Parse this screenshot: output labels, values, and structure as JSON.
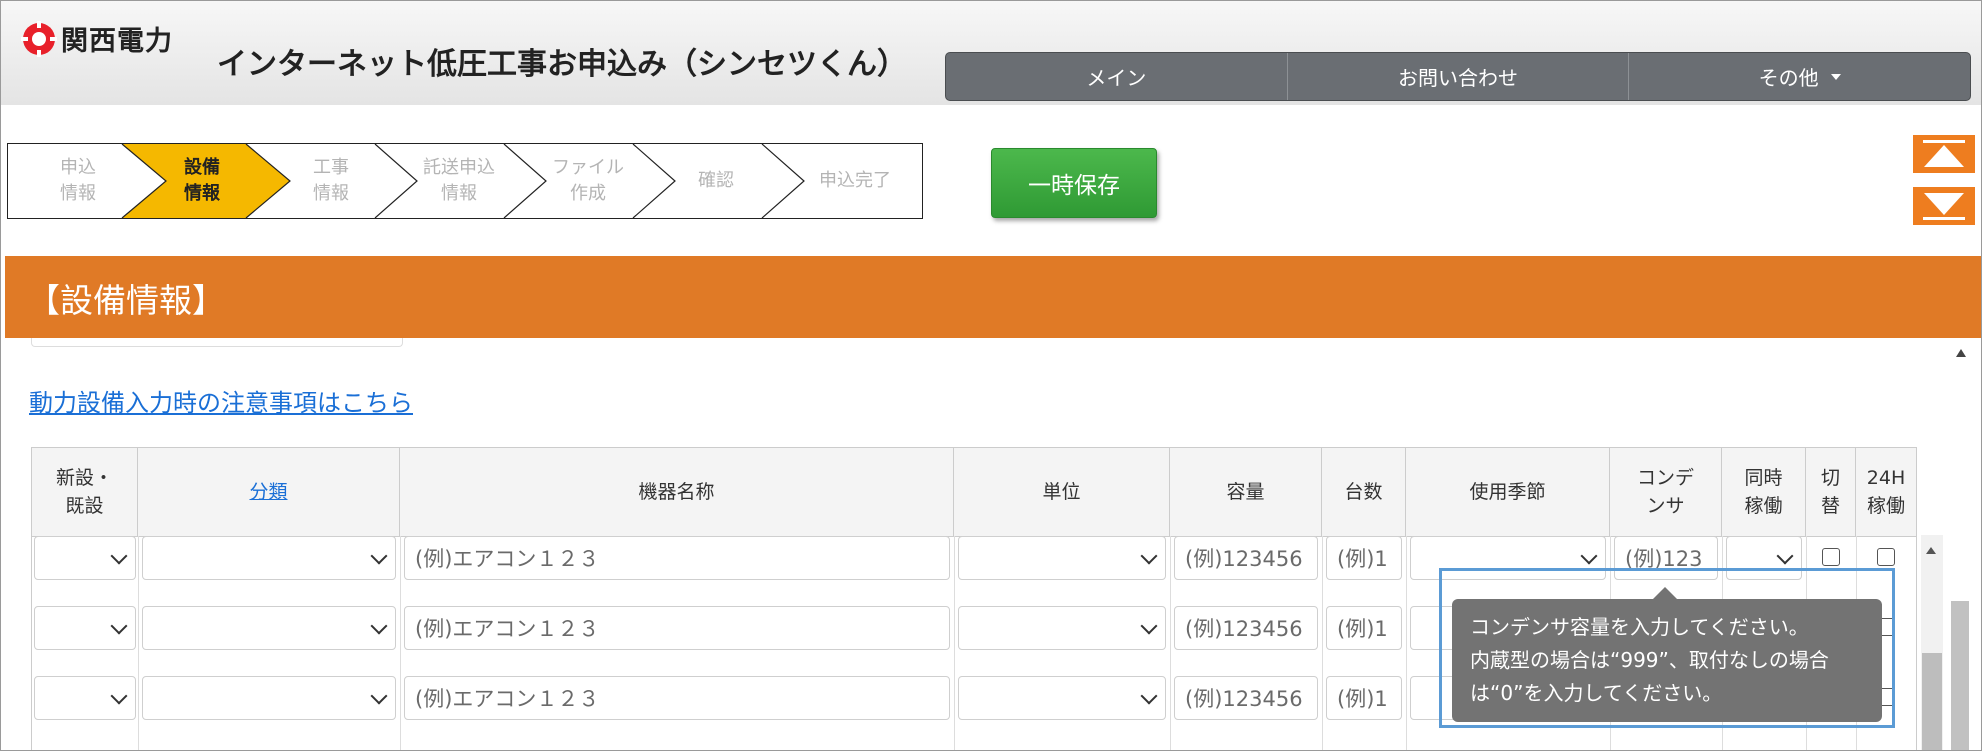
{
  "header": {
    "company": "関西電力",
    "app_title": "インターネット低圧工事お申込み（シンセツくん）",
    "nav": [
      {
        "label": "メイン"
      },
      {
        "label": "お問い合わせ"
      },
      {
        "label": "その他"
      }
    ],
    "brand_color": "#e8202a"
  },
  "steps": [
    {
      "line1": "申込",
      "line2": "情報",
      "state": "done"
    },
    {
      "line1": "設備",
      "line2": "情報",
      "state": "current"
    },
    {
      "line1": "工事",
      "line2": "情報",
      "state": "todo"
    },
    {
      "line1": "託送申込",
      "line2": "情報",
      "state": "todo"
    },
    {
      "line1": "ファイル",
      "line2": "作成",
      "state": "todo"
    },
    {
      "line1": "確認",
      "line2": "",
      "state": "todo"
    },
    {
      "line1": "申込完了",
      "line2": "",
      "state": "todo"
    }
  ],
  "save_button": "一時保存",
  "section_title": "【設備情報】",
  "notice_link": "動力設備入力時の注意事項はこちら",
  "table": {
    "headers": [
      {
        "line1": "新設・",
        "line2": "既設",
        "link": false
      },
      {
        "line1": "分類",
        "line2": "",
        "link": true
      },
      {
        "line1": "機器名称",
        "line2": "",
        "link": false
      },
      {
        "line1": "単位",
        "line2": "",
        "link": false
      },
      {
        "line1": "容量",
        "line2": "",
        "link": false
      },
      {
        "line1": "台数",
        "line2": "",
        "link": false
      },
      {
        "line1": "使用季節",
        "line2": "",
        "link": false
      },
      {
        "line1": "コンデ",
        "line2": "ンサ",
        "link": false
      },
      {
        "line1": "同時",
        "line2": "稼働",
        "link": false
      },
      {
        "line1": "切",
        "line2": "替",
        "link": false
      },
      {
        "line1": "24H",
        "line2": "稼働",
        "link": false
      }
    ],
    "rows": [
      {
        "kiki_placeholder": "(例)エアコン１２３",
        "capacity_placeholder": "(例)123456",
        "count_placeholder": "(例)1",
        "condenser_placeholder": "(例)123"
      },
      {
        "kiki_placeholder": "(例)エアコン１２３",
        "capacity_placeholder": "(例)123456",
        "count_placeholder": "(例)1",
        "condenser_placeholder": ""
      },
      {
        "kiki_placeholder": "(例)エアコン１２３",
        "capacity_placeholder": "(例)123456",
        "count_placeholder": "(例)1",
        "condenser_placeholder": ""
      }
    ]
  },
  "tooltip": {
    "lines": [
      "コンデンサ容量を入力してください。",
      "内蔵型の場合は“999”、取付なしの場合",
      "は“0”を入力してください。"
    ]
  },
  "colors": {
    "accent_orange": "#e07a26",
    "current_step": "#f5b800",
    "save_green": "#3aa63e",
    "link_blue": "#1a6fd6",
    "highlight_blue": "#5b9bd5"
  }
}
